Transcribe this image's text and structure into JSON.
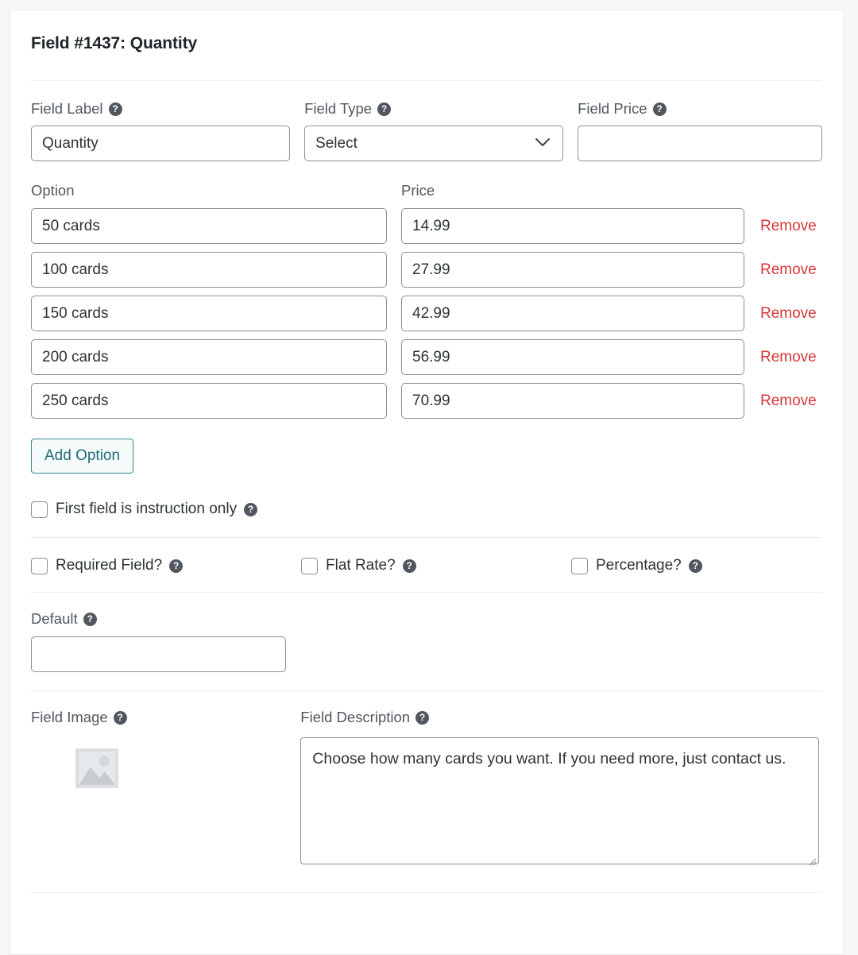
{
  "panel": {
    "title": "Field #1437: Quantity"
  },
  "top_fields": {
    "field_label": {
      "label": "Field Label",
      "help_icon": "help-icon",
      "value": "Quantity"
    },
    "field_type": {
      "label": "Field Type",
      "help_icon": "help-icon",
      "value": "Select",
      "chevron_icon": "chevron-down-icon",
      "options": [
        "Select"
      ]
    },
    "field_price": {
      "label": "Field Price",
      "help_icon": "help-icon",
      "value": ""
    }
  },
  "options_table": {
    "headers": {
      "option": "Option",
      "price": "Price"
    },
    "remove_label": "Remove",
    "remove_color": "#d63638",
    "rows": [
      {
        "option": "50 cards",
        "price": "14.99"
      },
      {
        "option": "100 cards",
        "price": "27.99"
      },
      {
        "option": "150 cards",
        "price": "42.99"
      },
      {
        "option": "200 cards",
        "price": "56.99"
      },
      {
        "option": "250 cards",
        "price": "70.99"
      }
    ],
    "add_option_label": "Add Option",
    "add_option_color": "#216b78"
  },
  "instruction_only": {
    "label": "First field is instruction only",
    "checked": false,
    "help_icon": "help-icon"
  },
  "checkbox_row": [
    {
      "label": "Required Field?",
      "checked": false,
      "help_icon": "help-icon"
    },
    {
      "label": "Flat Rate?",
      "checked": false,
      "help_icon": "help-icon"
    },
    {
      "label": "Percentage?",
      "checked": false,
      "help_icon": "help-icon"
    }
  ],
  "default_field": {
    "label": "Default",
    "help_icon": "help-icon",
    "value": ""
  },
  "field_image": {
    "label": "Field Image",
    "help_icon": "help-icon",
    "placeholder_icon": "image-placeholder-icon"
  },
  "field_description": {
    "label": "Field Description",
    "help_icon": "help-icon",
    "value": "Choose how many cards you want. If you need more, just contact us.",
    "resize_handle_icon": "resize-grip-icon"
  }
}
